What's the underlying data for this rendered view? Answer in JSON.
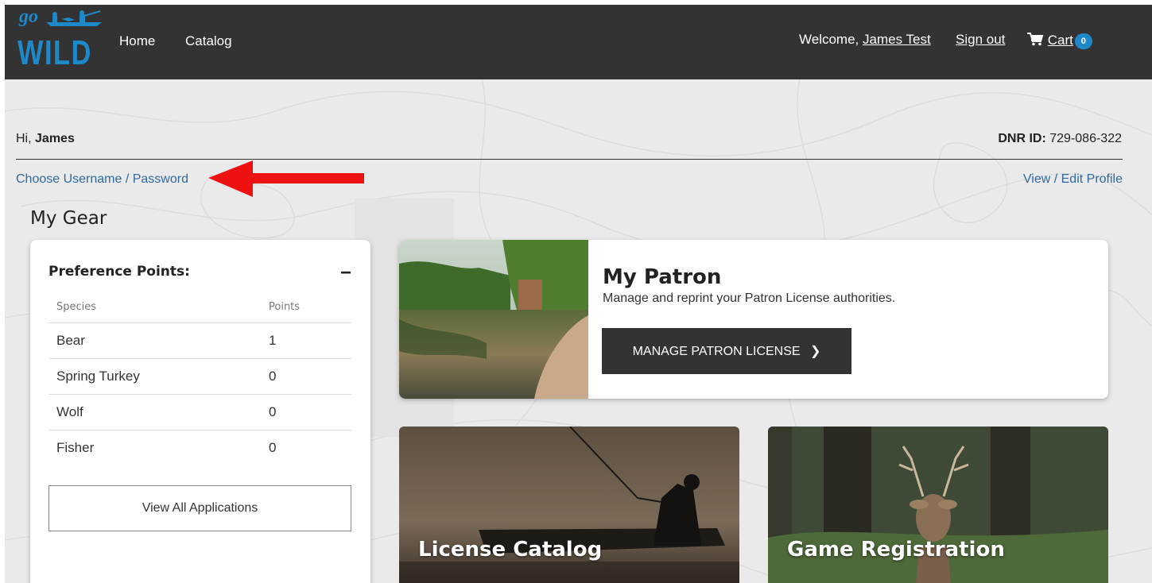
{
  "header": {
    "logo_top": "go",
    "logo_main": "WILD",
    "nav": {
      "home": "Home",
      "catalog": "Catalog"
    },
    "welcome_prefix": "Welcome,",
    "user_name": "James Test",
    "sign_out": "Sign out",
    "cart_label": "Cart",
    "cart_count": "0"
  },
  "profile": {
    "greeting": "Hi,",
    "first_name": "James",
    "dnr_label": "DNR ID:",
    "dnr_value": "729-086-322",
    "choose_credentials": "Choose Username / Password",
    "view_edit_profile": "View / Edit Profile"
  },
  "my_gear": {
    "title": "My Gear",
    "preference_points": {
      "title": "Preference Points:",
      "collapse_symbol": "−",
      "columns": {
        "species": "Species",
        "points": "Points"
      },
      "rows": [
        {
          "species": "Bear",
          "points": "1"
        },
        {
          "species": "Spring Turkey",
          "points": "0"
        },
        {
          "species": "Wolf",
          "points": "0"
        },
        {
          "species": "Fisher",
          "points": "0"
        }
      ],
      "view_all_button": "View All Applications"
    },
    "patron": {
      "title": "My Patron",
      "description": "Manage and reprint your Patron License authorities.",
      "button": "MANAGE PATRON LICENSE",
      "button_chevron": "❯"
    },
    "tiles": {
      "license_catalog": "License Catalog",
      "game_registration": "Game Registration"
    }
  },
  "colors": {
    "header_bg": "#333333",
    "brand_blue": "#1e88c8",
    "link_blue": "#2e6aa0",
    "annotation_arrow": "#ee1111"
  }
}
